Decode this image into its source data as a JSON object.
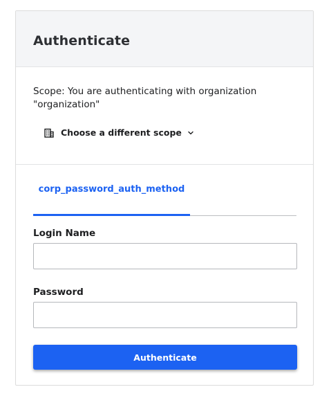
{
  "card": {
    "title": "Authenticate"
  },
  "scope": {
    "description": "Scope: You are authenticating with organization \"organization\"",
    "toggle_label": "Choose a different scope",
    "toggle_icon": "building-icon",
    "chevron_icon": "chevron-down-icon"
  },
  "auth_methods": {
    "tabs": [
      {
        "label": "corp_password_auth_method",
        "active": true
      }
    ]
  },
  "form": {
    "login_name_label": "Login Name",
    "login_name_value": "",
    "password_label": "Password",
    "password_value": "",
    "submit_label": "Authenticate"
  },
  "colors": {
    "accent": "#1c62f2",
    "header_bg": "#f4f5f7",
    "border": "#dcdcdc"
  }
}
